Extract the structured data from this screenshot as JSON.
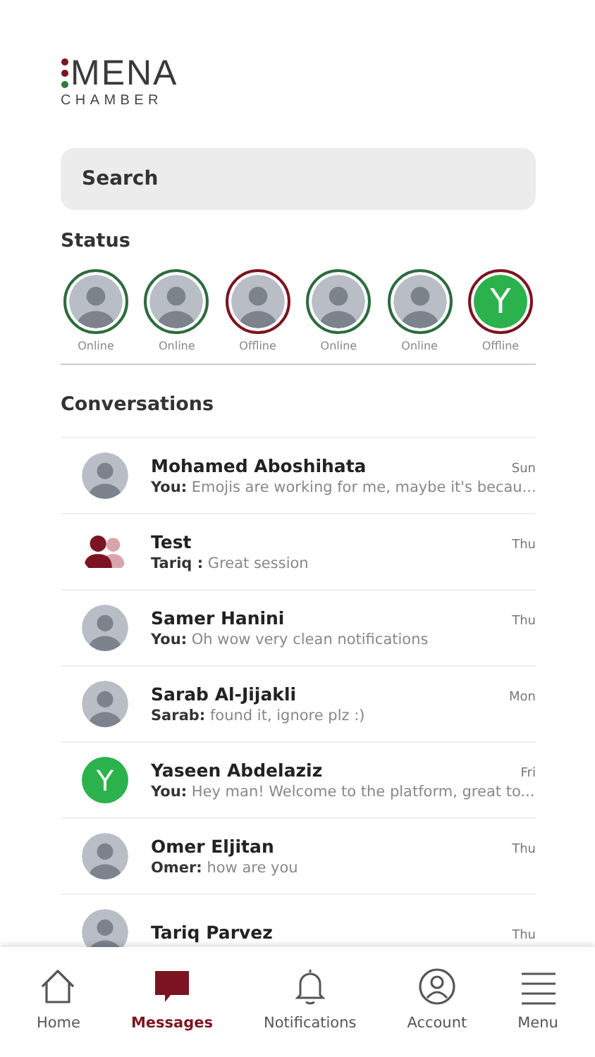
{
  "logo": {
    "title": "MENA",
    "subtitle": "CHAMBER"
  },
  "search": {
    "placeholder": "Search"
  },
  "status": {
    "title": "Status",
    "people": [
      {
        "kind": "photo",
        "online": true,
        "label": "Online"
      },
      {
        "kind": "photo",
        "online": true,
        "label": "Online"
      },
      {
        "kind": "photo",
        "online": false,
        "label": "Offline"
      },
      {
        "kind": "photo",
        "online": true,
        "label": "Online"
      },
      {
        "kind": "photo",
        "online": true,
        "label": "Online"
      },
      {
        "kind": "letter",
        "letter": "Y",
        "online": false,
        "label": "Offline"
      }
    ]
  },
  "conversations": {
    "title": "Conversations",
    "items": [
      {
        "kind": "photo",
        "name": "Mohamed Aboshihata",
        "time": "Sun",
        "sender": "You:",
        "text": "Emojis are working for me, maybe it's becau..."
      },
      {
        "kind": "group",
        "name": "Test",
        "time": "Thu",
        "sender": "Tariq :",
        "text": "Great session"
      },
      {
        "kind": "photo",
        "name": "Samer Hanini",
        "time": "Thu",
        "sender": "You:",
        "text": "Oh wow very clean notifications"
      },
      {
        "kind": "photo",
        "name": "Sarab Al-Jijakli",
        "time": "Mon",
        "sender": "Sarab:",
        "text": "found it, ignore plz :)"
      },
      {
        "kind": "letter",
        "letter": "Y",
        "name": "Yaseen Abdelaziz",
        "time": "Fri",
        "sender": "You:",
        "text": "Hey man! Welcome to the platform, great to..."
      },
      {
        "kind": "photo",
        "name": "Omer Eljitan",
        "time": "Thu",
        "sender": "Omer:",
        "text": "how are you"
      },
      {
        "kind": "photo",
        "name": "Tariq Parvez",
        "time": "Thu"
      }
    ]
  },
  "nav": [
    {
      "kind": "home",
      "label": "Home",
      "selected": false
    },
    {
      "kind": "messages",
      "label": "Messages",
      "selected": true
    },
    {
      "kind": "bell",
      "label": "Notifications",
      "selected": false
    },
    {
      "kind": "account",
      "label": "Account",
      "selected": false
    },
    {
      "kind": "menu",
      "label": "Menu",
      "selected": false
    }
  ]
}
